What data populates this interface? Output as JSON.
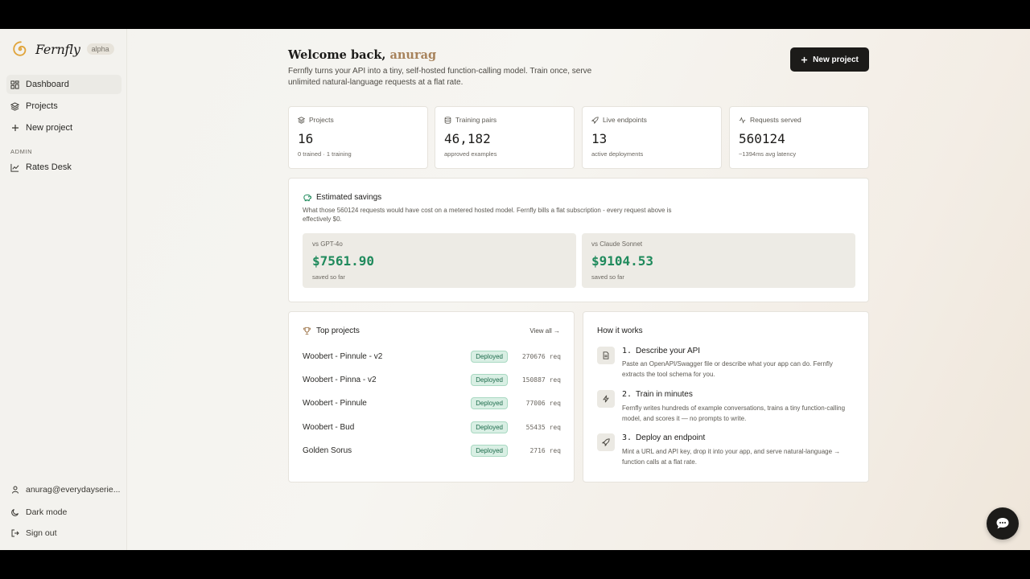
{
  "brand": {
    "name": "Fernfly",
    "badge": "alpha"
  },
  "sidebar": {
    "items": [
      {
        "label": "Dashboard",
        "icon": "dashboard-icon",
        "active": true
      },
      {
        "label": "Projects",
        "icon": "layers-icon"
      },
      {
        "label": "New project",
        "icon": "plus-icon"
      }
    ],
    "admin_label": "ADMIN",
    "admin_items": [
      {
        "label": "Rates Desk",
        "icon": "chart-line-icon"
      }
    ],
    "user_email": "anurag@everydayserie...",
    "dark_mode_label": "Dark mode",
    "sign_out_label": "Sign out"
  },
  "header": {
    "welcome_prefix": "Welcome back,",
    "user_name": "anurag",
    "intro": "Fernfly turns your API into a tiny, self-hosted function-calling model. Train once, serve unlimited natural-language requests at a flat rate.",
    "new_project_label": "New project"
  },
  "stats": [
    {
      "label": "Projects",
      "value": "16",
      "sub": "0 trained · 1 training",
      "icon": "layers-icon"
    },
    {
      "label": "Training pairs",
      "value": "46,182",
      "sub": "approved examples",
      "icon": "database-icon"
    },
    {
      "label": "Live endpoints",
      "value": "13",
      "sub": "active deployments",
      "icon": "rocket-icon"
    },
    {
      "label": "Requests served",
      "value": "560124",
      "sub": "~1394ms avg latency",
      "icon": "activity-icon"
    }
  ],
  "savings": {
    "title": "Estimated savings",
    "description": "What those 560124 requests would have cost on a metered hosted model. Fernfly bills a flat subscription - every request above is effectively $0.",
    "cards": [
      {
        "label": "vs GPT-4o",
        "value": "$7561.90",
        "sub": "saved so far"
      },
      {
        "label": "vs Claude Sonnet",
        "value": "$9104.53",
        "sub": "saved so far"
      }
    ]
  },
  "top_projects": {
    "title": "Top projects",
    "view_all": "View all →",
    "rows": [
      {
        "name": "Woobert - Pinnule - v2",
        "status": "Deployed",
        "requests": "270676 req"
      },
      {
        "name": "Woobert - Pinna - v2",
        "status": "Deployed",
        "requests": "150887 req"
      },
      {
        "name": "Woobert - Pinnule",
        "status": "Deployed",
        "requests": "77006 req"
      },
      {
        "name": "Woobert - Bud",
        "status": "Deployed",
        "requests": "55435 req"
      },
      {
        "name": "Golden Sorus",
        "status": "Deployed",
        "requests": "2716 req"
      }
    ]
  },
  "how_it_works": {
    "title": "How it works",
    "steps": [
      {
        "num": "1.",
        "title": "Describe your API",
        "desc": "Paste an OpenAPI/Swagger file or describe what your app can do. Fernfly extracts the tool schema for you.",
        "icon": "document-icon"
      },
      {
        "num": "2.",
        "title": "Train in minutes",
        "desc": "Fernfly writes hundreds of example conversations, trains a tiny function-calling model, and scores it — no prompts to write.",
        "icon": "lightning-icon"
      },
      {
        "num": "3.",
        "title": "Deploy an endpoint",
        "desc": "Mint a URL and API key, drop it into your app, and serve natural-language → function calls at a flat rate.",
        "icon": "rocket-icon"
      }
    ]
  },
  "colors": {
    "accent_user": "#a7825b",
    "savings_green": "#1f8a5c",
    "deployed_bg": "#d9efe4",
    "button_dark": "#1c1b19"
  }
}
